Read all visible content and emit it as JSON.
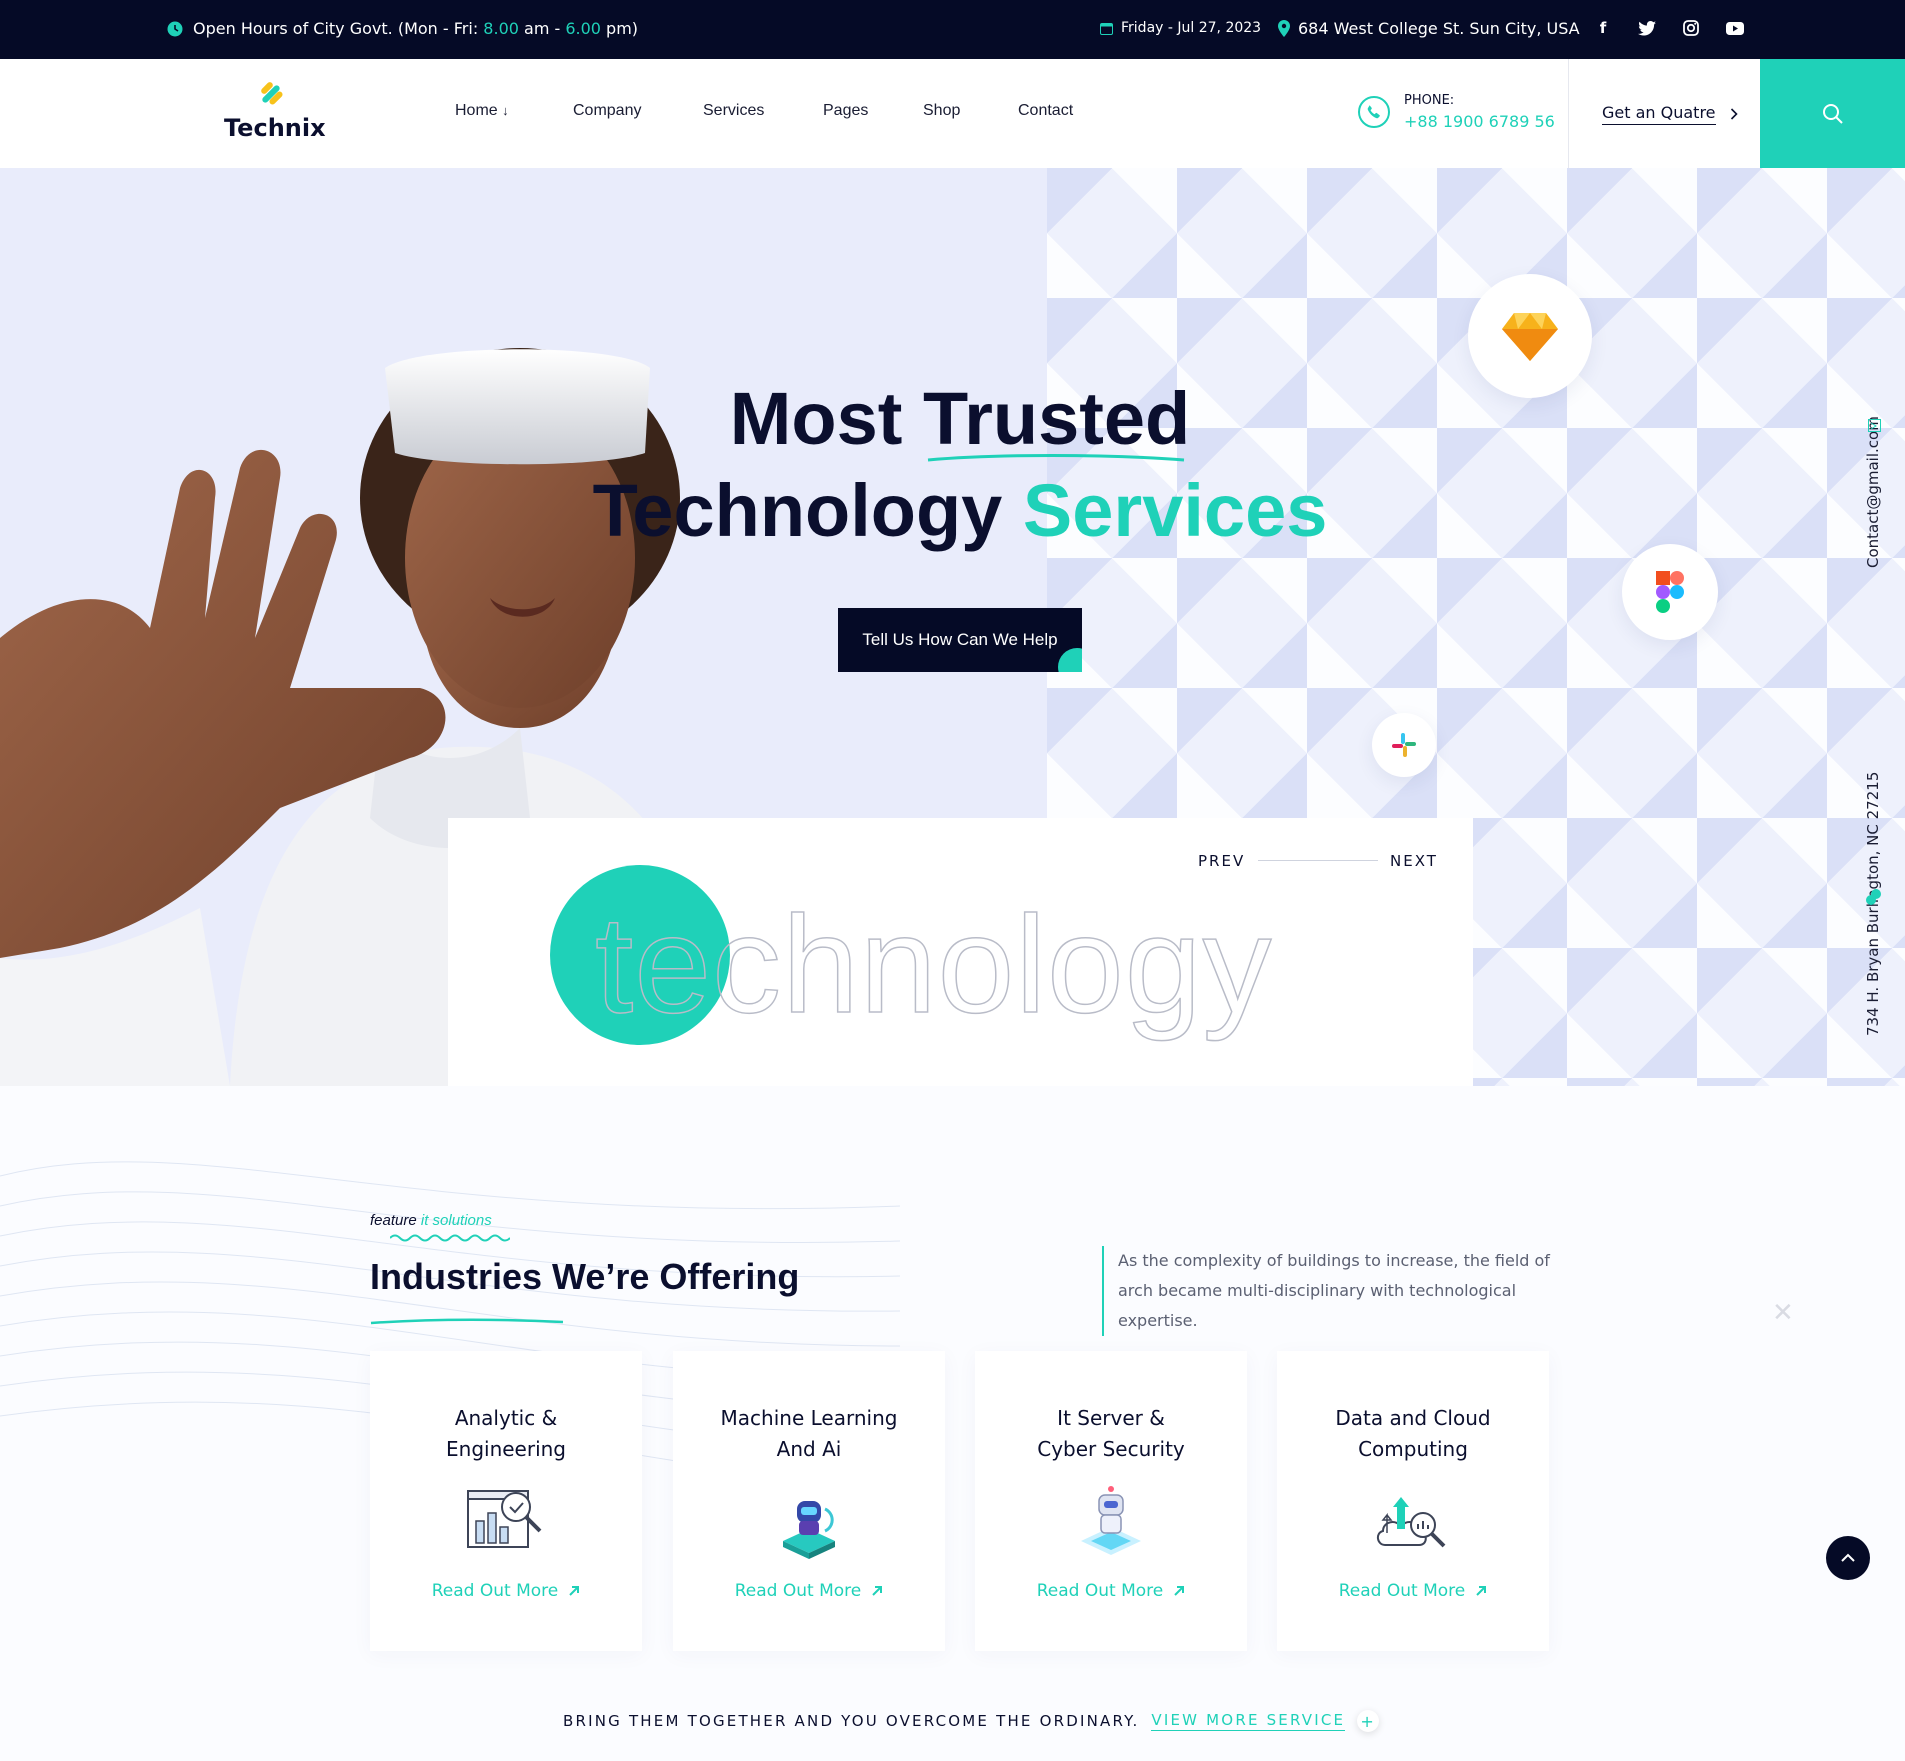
{
  "topbar": {
    "hours_prefix": "Open Hours of City Govt. (Mon - Fri: ",
    "hours_start": "8.00",
    "hours_mid": " am - ",
    "hours_end": "6.00",
    "hours_suffix": " pm)",
    "date": "Friday - Jul 27, 2023",
    "address": "684 West College St. Sun City, USA",
    "social": [
      {
        "icon": "facebook-icon",
        "glyph": "f"
      },
      {
        "icon": "twitter-icon",
        "glyph": "t"
      },
      {
        "icon": "instagram-icon",
        "glyph": "◎"
      },
      {
        "icon": "youtube-icon",
        "glyph": "▶"
      }
    ]
  },
  "brand": {
    "name": "Technix"
  },
  "nav": {
    "items": [
      "Home",
      "Company",
      "Services",
      "Pages",
      "Shop",
      "Contact"
    ],
    "home_arrow": "↓"
  },
  "phone": {
    "label": "PHONE:",
    "number": "+88 1900 6789 56"
  },
  "quote": {
    "label": "Get an Quatre"
  },
  "hero": {
    "title_line1": "Most Trusted",
    "title_line2_a": "Technology ",
    "title_line2_b": "Services",
    "button": "Tell Us How Can We Help",
    "side_email": "Contact@gmail.com",
    "side_address": "734 H. Bryan Burlington, NC 27215",
    "float_icons": [
      "sketch-icon",
      "figma-icon",
      "slack-icon"
    ]
  },
  "slider": {
    "prev": "PREV",
    "next": "NEXT",
    "word": "technology"
  },
  "features": {
    "tag_a": "feature",
    "tag_b": "it solutions",
    "heading": "Industries We’re Offering",
    "description": "As the complexity of buildings to increase, the field of arch became multi-disciplinary with technological expertise.",
    "cards": [
      {
        "title": "Analytic &\nEngineering",
        "link": "Read Out More",
        "icon": "analytics-icon"
      },
      {
        "title": "Machine Learning\nAnd Ai",
        "link": "Read Out More",
        "icon": "robot-icon"
      },
      {
        "title": "It Server &\nCyber Security",
        "link": "Read Out More",
        "icon": "server-robot-icon"
      },
      {
        "title": "Data and Cloud\nComputing",
        "link": "Read Out More",
        "icon": "cloud-data-icon"
      }
    ],
    "bring_text": "BRING THEM TOGETHER AND YOU OVERCOME THE ORDINARY.",
    "bring_link": "VIEW MORE SERVICE",
    "bring_plus": "+"
  },
  "colors": {
    "accent": "#1fd1b8",
    "dark": "#050a26",
    "yellow": "#f7c21b"
  }
}
